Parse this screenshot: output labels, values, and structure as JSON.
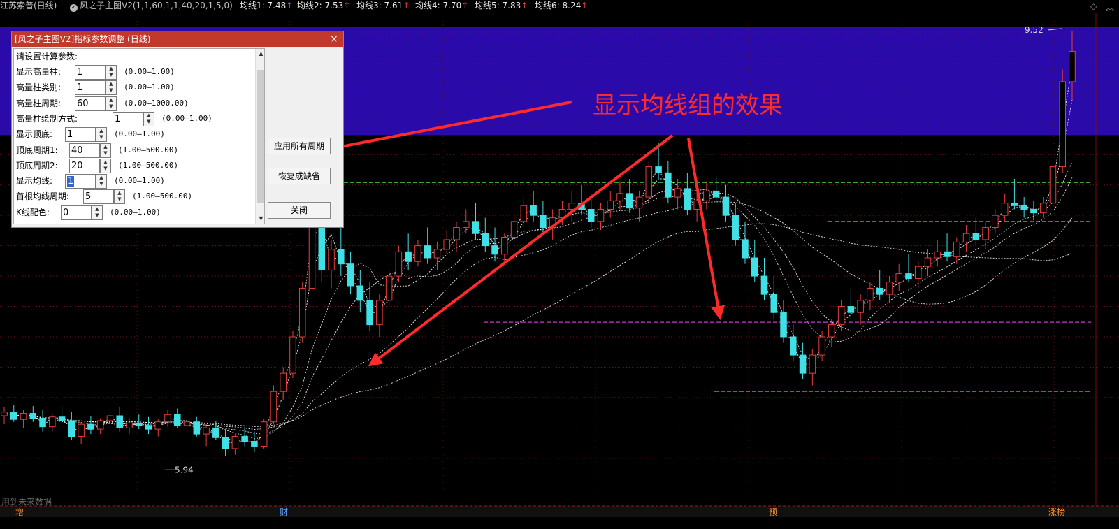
{
  "header": {
    "stock": "江苏索普(日线)",
    "indicator": "风之子主图V2(1,1,60,1,1,40,20,1,5,0)",
    "ma": [
      {
        "label": "均线1:",
        "value": "7.48",
        "arrow": "↑"
      },
      {
        "label": "均线2:",
        "value": "7.53",
        "arrow": "↑"
      },
      {
        "label": "均线3:",
        "value": "7.61",
        "arrow": "↑"
      },
      {
        "label": "均线4:",
        "value": "7.70",
        "arrow": "↑"
      },
      {
        "label": "均线5:",
        "value": "7.83",
        "arrow": "↑"
      },
      {
        "label": "均线6:",
        "value": "8.24",
        "arrow": "↑"
      }
    ],
    "corner_icons": [
      "diamond-icon",
      "double-up-icon"
    ]
  },
  "chart_labels": {
    "high": "9.52",
    "low": "5.94",
    "annotation": "显示均线组的效果",
    "future_hint": "用到未来数据",
    "markers": [
      "增",
      "财",
      "预",
      "涨榜"
    ]
  },
  "dialog": {
    "title": "[风之子主图V2]指标参数调整 (日线)",
    "close": "×",
    "prompt": "请设置计算参数:",
    "params": [
      {
        "label": "显示高量柱:",
        "value": "1",
        "range": "(0.00—1.00)"
      },
      {
        "label": "高量柱类别:",
        "value": "1",
        "range": "(0.00—1.00)"
      },
      {
        "label": "高量柱周期:",
        "value": "60",
        "range": "(0.00—1000.00)"
      },
      {
        "label": "高量柱绘制方式:",
        "value": "1",
        "range": "(0.00—1.00)"
      },
      {
        "label": "显示顶底:",
        "value": "1",
        "range": "(0.00—1.00)"
      },
      {
        "label": "顶底周期1:",
        "value": "40",
        "range": "(1.00—500.00)"
      },
      {
        "label": "顶底周期2:",
        "value": "20",
        "range": "(1.00—500.00)"
      },
      {
        "label": "显示均线:",
        "value": "1",
        "range": "(0.00—1.00)"
      },
      {
        "label": "首根均线周期:",
        "value": "5",
        "range": "(1.00—500.00)"
      },
      {
        "label": "K线配色:",
        "value": "0",
        "range": "(0.00—1.00)"
      }
    ],
    "buttons": {
      "apply_all": "应用所有周期",
      "restore": "恢复成缺省",
      "close": "关闭"
    }
  },
  "colors": {
    "up": "#e83c3c",
    "down": "#3fe0e6",
    "band": "#2a0aa8",
    "annotation": "#ff2a2a",
    "ma": "#ffffff",
    "green_line": "#3cbf3c",
    "magenta_line": "#c23cc8"
  },
  "chart_data": {
    "type": "candlestick",
    "title": "",
    "xlabel": "",
    "ylabel": "",
    "y_range": [
      5.7,
      9.6
    ],
    "high": 9.52,
    "low": 5.94,
    "candles": [
      [
        6.35,
        6.42,
        6.28,
        6.38
      ],
      [
        6.38,
        6.44,
        6.3,
        6.32
      ],
      [
        6.32,
        6.4,
        6.25,
        6.37
      ],
      [
        6.37,
        6.43,
        6.3,
        6.33
      ],
      [
        6.33,
        6.4,
        6.22,
        6.26
      ],
      [
        6.26,
        6.36,
        6.22,
        6.34
      ],
      [
        6.34,
        6.42,
        6.29,
        6.31
      ],
      [
        6.31,
        6.38,
        6.15,
        6.18
      ],
      [
        6.18,
        6.3,
        6.12,
        6.28
      ],
      [
        6.28,
        6.35,
        6.2,
        6.24
      ],
      [
        6.24,
        6.33,
        6.2,
        6.31
      ],
      [
        6.31,
        6.4,
        6.28,
        6.35
      ],
      [
        6.35,
        6.42,
        6.22,
        6.25
      ],
      [
        6.25,
        6.33,
        6.2,
        6.29
      ],
      [
        6.29,
        6.36,
        6.24,
        6.27
      ],
      [
        6.27,
        6.34,
        6.2,
        6.24
      ],
      [
        6.24,
        6.32,
        6.18,
        6.3
      ],
      [
        6.3,
        6.4,
        6.26,
        6.36
      ],
      [
        6.36,
        6.41,
        6.25,
        6.27
      ],
      [
        6.27,
        6.35,
        6.22,
        6.3
      ],
      [
        6.3,
        6.34,
        6.18,
        6.2
      ],
      [
        6.2,
        6.28,
        6.1,
        6.25
      ],
      [
        6.25,
        6.31,
        6.15,
        6.17
      ],
      [
        6.17,
        6.24,
        6.02,
        6.08
      ],
      [
        6.08,
        6.2,
        6.03,
        6.18
      ],
      [
        6.18,
        6.26,
        6.1,
        6.14
      ],
      [
        6.14,
        6.22,
        6.05,
        6.1
      ],
      [
        6.1,
        6.32,
        6.08,
        6.3
      ],
      [
        6.3,
        6.6,
        6.28,
        6.55
      ],
      [
        6.55,
        6.75,
        6.48,
        6.7
      ],
      [
        6.7,
        7.05,
        6.66,
        7.0
      ],
      [
        7.0,
        7.45,
        6.95,
        7.4
      ],
      [
        7.4,
        8.3,
        7.35,
        8.25
      ],
      [
        8.25,
        8.36,
        7.45,
        7.55
      ],
      [
        7.55,
        7.8,
        7.4,
        7.72
      ],
      [
        7.72,
        7.9,
        7.5,
        7.6
      ],
      [
        7.6,
        7.7,
        7.35,
        7.42
      ],
      [
        7.42,
        7.55,
        7.2,
        7.3
      ],
      [
        7.3,
        7.45,
        7.05,
        7.1
      ],
      [
        7.1,
        7.35,
        7.0,
        7.3
      ],
      [
        7.3,
        7.55,
        7.25,
        7.5
      ],
      [
        7.5,
        7.75,
        7.45,
        7.7
      ],
      [
        7.7,
        7.85,
        7.55,
        7.62
      ],
      [
        7.62,
        7.8,
        7.58,
        7.75
      ],
      [
        7.75,
        7.9,
        7.6,
        7.65
      ],
      [
        7.65,
        7.78,
        7.55,
        7.72
      ],
      [
        7.72,
        7.88,
        7.68,
        7.8
      ],
      [
        7.8,
        7.95,
        7.7,
        7.9
      ],
      [
        7.9,
        8.05,
        7.85,
        7.95
      ],
      [
        7.95,
        8.1,
        7.8,
        7.85
      ],
      [
        7.85,
        7.98,
        7.7,
        7.75
      ],
      [
        7.75,
        7.9,
        7.62,
        7.68
      ],
      [
        7.68,
        7.85,
        7.6,
        7.82
      ],
      [
        7.82,
        8.0,
        7.78,
        7.95
      ],
      [
        7.95,
        8.15,
        7.9,
        8.08
      ],
      [
        8.08,
        8.2,
        7.95,
        8.0
      ],
      [
        8.0,
        8.12,
        7.85,
        7.9
      ],
      [
        7.9,
        8.05,
        7.8,
        7.98
      ],
      [
        7.98,
        8.12,
        7.92,
        8.05
      ],
      [
        8.05,
        8.2,
        7.95,
        8.1
      ],
      [
        8.1,
        8.25,
        8.0,
        8.05
      ],
      [
        8.05,
        8.18,
        7.9,
        7.95
      ],
      [
        7.95,
        8.1,
        7.88,
        8.05
      ],
      [
        8.05,
        8.2,
        7.98,
        8.12
      ],
      [
        8.12,
        8.28,
        8.05,
        8.18
      ],
      [
        8.18,
        8.3,
        8.02,
        8.06
      ],
      [
        8.06,
        8.2,
        7.95,
        8.15
      ],
      [
        8.15,
        8.45,
        8.1,
        8.4
      ],
      [
        8.4,
        8.6,
        8.3,
        8.35
      ],
      [
        8.35,
        8.45,
        8.1,
        8.15
      ],
      [
        8.15,
        8.3,
        8.05,
        8.22
      ],
      [
        8.22,
        8.35,
        8.0,
        8.05
      ],
      [
        8.05,
        8.2,
        7.95,
        8.12
      ],
      [
        8.12,
        8.28,
        8.05,
        8.2
      ],
      [
        8.2,
        8.32,
        8.1,
        8.15
      ],
      [
        8.15,
        8.25,
        7.95,
        8.0
      ],
      [
        8.0,
        8.1,
        7.75,
        7.8
      ],
      [
        7.8,
        7.95,
        7.6,
        7.65
      ],
      [
        7.65,
        7.8,
        7.45,
        7.5
      ],
      [
        7.5,
        7.65,
        7.3,
        7.35
      ],
      [
        7.35,
        7.5,
        7.15,
        7.2
      ],
      [
        7.2,
        7.3,
        6.95,
        7.0
      ],
      [
        7.0,
        7.1,
        6.8,
        6.85
      ],
      [
        6.85,
        6.95,
        6.65,
        6.7
      ],
      [
        6.7,
        6.9,
        6.6,
        6.85
      ],
      [
        6.85,
        7.05,
        6.8,
        7.0
      ],
      [
        7.0,
        7.15,
        6.92,
        7.1
      ],
      [
        7.1,
        7.3,
        7.05,
        7.25
      ],
      [
        7.25,
        7.4,
        7.15,
        7.2
      ],
      [
        7.2,
        7.35,
        7.1,
        7.3
      ],
      [
        7.3,
        7.45,
        7.22,
        7.4
      ],
      [
        7.4,
        7.55,
        7.3,
        7.35
      ],
      [
        7.35,
        7.5,
        7.28,
        7.45
      ],
      [
        7.45,
        7.6,
        7.38,
        7.52
      ],
      [
        7.52,
        7.68,
        7.45,
        7.48
      ],
      [
        7.48,
        7.62,
        7.4,
        7.58
      ],
      [
        7.58,
        7.72,
        7.5,
        7.65
      ],
      [
        7.65,
        7.8,
        7.58,
        7.7
      ],
      [
        7.7,
        7.85,
        7.62,
        7.66
      ],
      [
        7.66,
        7.82,
        7.6,
        7.78
      ],
      [
        7.78,
        7.92,
        7.7,
        7.85
      ],
      [
        7.85,
        7.98,
        7.75,
        7.8
      ],
      [
        7.8,
        7.95,
        7.72,
        7.9
      ],
      [
        7.9,
        8.05,
        7.85,
        8.0
      ],
      [
        8.0,
        8.18,
        7.95,
        8.1
      ],
      [
        8.1,
        8.3,
        8.05,
        8.08
      ],
      [
        8.08,
        8.15,
        7.98,
        8.05
      ],
      [
        8.05,
        8.12,
        7.96,
        8.02
      ],
      [
        8.02,
        8.15,
        7.98,
        8.1
      ],
      [
        8.1,
        8.45,
        8.05,
        8.4
      ],
      [
        8.4,
        9.2,
        8.35,
        9.1
      ],
      [
        9.1,
        9.52,
        8.95,
        9.35
      ]
    ],
    "horizontal_levels": [
      {
        "value": 8.27,
        "color": "green"
      },
      {
        "value": 7.95,
        "color": "green"
      },
      {
        "value": 7.12,
        "color": "magenta"
      },
      {
        "value": 6.55,
        "color": "magenta"
      }
    ],
    "ma_periods": [
      5,
      10,
      20,
      30,
      60,
      120
    ]
  }
}
